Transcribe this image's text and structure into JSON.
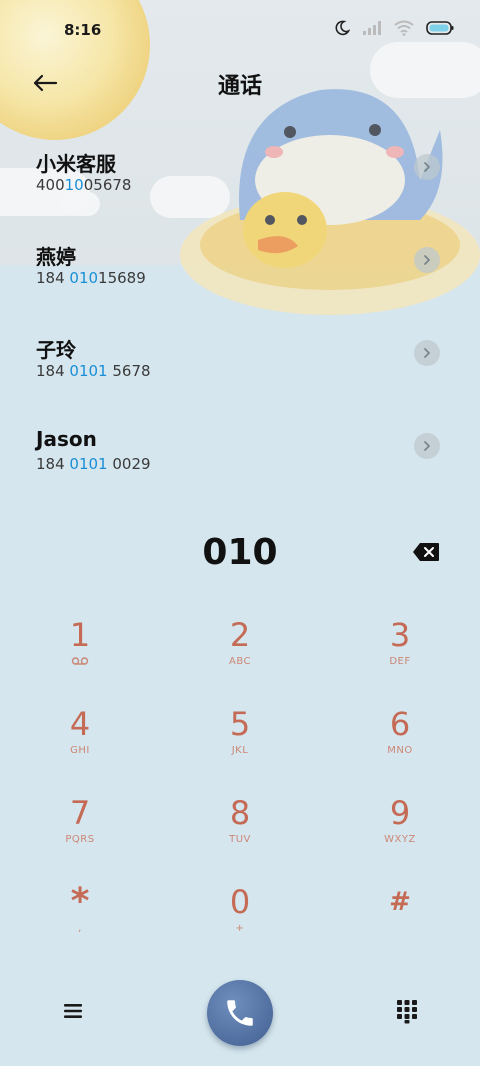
{
  "status_bar": {
    "time": "8:16"
  },
  "header": {
    "title": "通话"
  },
  "contacts": [
    {
      "name": "小米客服",
      "number_pre": "400",
      "number_hl": "10",
      "number_post": "05678"
    },
    {
      "name": "燕婷",
      "number_pre": "184 ",
      "number_hl": "010",
      "number_post": "15689"
    },
    {
      "name": "子玲",
      "number_pre": "184 ",
      "number_hl": "0101",
      "number_post": " 5678"
    },
    {
      "name": "Jason",
      "number_pre": "184 ",
      "number_hl": "0101",
      "number_post": " 0029"
    }
  ],
  "dialer": {
    "entered_number": "010"
  },
  "keypad": [
    {
      "digit": "1",
      "letters": ""
    },
    {
      "digit": "2",
      "letters": "ABC"
    },
    {
      "digit": "3",
      "letters": "DEF"
    },
    {
      "digit": "4",
      "letters": "GHI"
    },
    {
      "digit": "5",
      "letters": "JKL"
    },
    {
      "digit": "6",
      "letters": "MNO"
    },
    {
      "digit": "7",
      "letters": "PQRS"
    },
    {
      "digit": "8",
      "letters": "TUV"
    },
    {
      "digit": "9",
      "letters": "WXYZ"
    },
    {
      "digit": "*",
      "letters": ","
    },
    {
      "digit": "0",
      "letters": "+"
    },
    {
      "digit": "#",
      "letters": ""
    }
  ],
  "icons": {
    "back": "back-arrow-icon",
    "moon": "moon-icon",
    "signal": "signal-icon",
    "wifi": "wifi-icon",
    "battery": "battery-icon",
    "chevron": "chevron-right-icon",
    "backspace": "backspace-icon",
    "voicemail": "voicemail-icon",
    "menu": "menu-icon",
    "phone": "phone-icon",
    "dialpad": "dialpad-icon"
  },
  "colors": {
    "highlight": "#1a8fd6",
    "key_digit": "#c46a55",
    "call_button": "#4f6d9e"
  }
}
